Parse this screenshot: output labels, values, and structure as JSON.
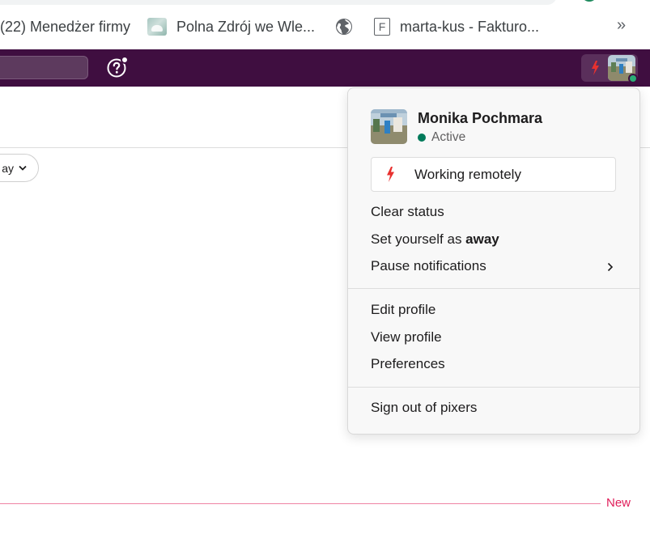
{
  "bookmarks": [
    {
      "label": "(22) Menedżer firmy",
      "icon": "facebook-bookmark"
    },
    {
      "label": "Polna Zdrój we Wle...",
      "icon": "site-image-favicon"
    },
    {
      "label": "",
      "icon": "globe-icon"
    },
    {
      "label": "marta-kus - Fakturo...",
      "icon": "f-letter-favicon",
      "icon_letter": "F"
    }
  ],
  "bookmarks_more": "»",
  "topbar": {
    "background": "#3f0e40",
    "help_icon": "question-circle-icon",
    "status_icon": "lightning-icon"
  },
  "filter": {
    "label": "ay"
  },
  "divider": {
    "new_label": "New",
    "color": "#e01e5a"
  },
  "user_menu": {
    "name": "Monika Pochmara",
    "presence": "Active",
    "presence_color": "#007a5a",
    "status": {
      "emoji": "lightning-icon",
      "text": "Working remotely"
    },
    "clear_status": "Clear status",
    "set_away_prefix": "Set yourself as ",
    "set_away_bold": "away",
    "pause_notifications": "Pause notifications",
    "edit_profile": "Edit profile",
    "view_profile": "View profile",
    "preferences": "Preferences",
    "sign_out": "Sign out of pixers"
  }
}
